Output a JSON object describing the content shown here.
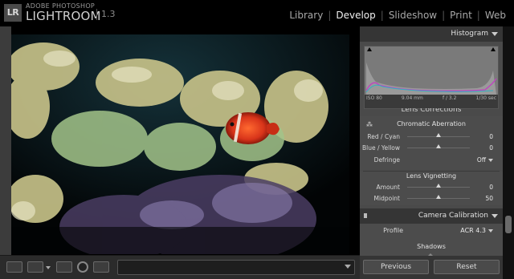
{
  "app": {
    "logo": "LR",
    "brand_top": "ADOBE PHOTOSHOP",
    "brand_main": "LIGHTROOM",
    "version": "1.3"
  },
  "modules": [
    {
      "label": "Library",
      "active": false
    },
    {
      "label": "Develop",
      "active": true
    },
    {
      "label": "Slideshow",
      "active": false
    },
    {
      "label": "Print",
      "active": false
    },
    {
      "label": "Web",
      "active": false
    }
  ],
  "histogram": {
    "title": "Histogram",
    "iso": "ISO 80",
    "focal": "9.04 mm",
    "aperture": "f / 3.2",
    "shutter": "1/30 sec"
  },
  "lens_corrections": {
    "clipped_title": "Lens Corrections",
    "chromatic_title": "Chromatic Aberration",
    "red_cyan": {
      "label": "Red / Cyan",
      "value": "0"
    },
    "blue_yellow": {
      "label": "Blue / Yellow",
      "value": "0"
    },
    "defringe": {
      "label": "Defringe",
      "value": "Off"
    },
    "vignetting_title": "Lens Vignetting",
    "amount": {
      "label": "Amount",
      "value": "0"
    },
    "midpoint": {
      "label": "Midpoint",
      "value": "50"
    }
  },
  "camera_calibration": {
    "title": "Camera Calibration",
    "profile_label": "Profile",
    "profile_value": "ACR 4.3",
    "shadows_title": "Shadows"
  },
  "buttons": {
    "previous": "Previous",
    "reset": "Reset"
  },
  "colors": {
    "panel_bg": "#4a4a4a",
    "header_bg": "#353535",
    "accent_active": "#f0f0f0"
  }
}
